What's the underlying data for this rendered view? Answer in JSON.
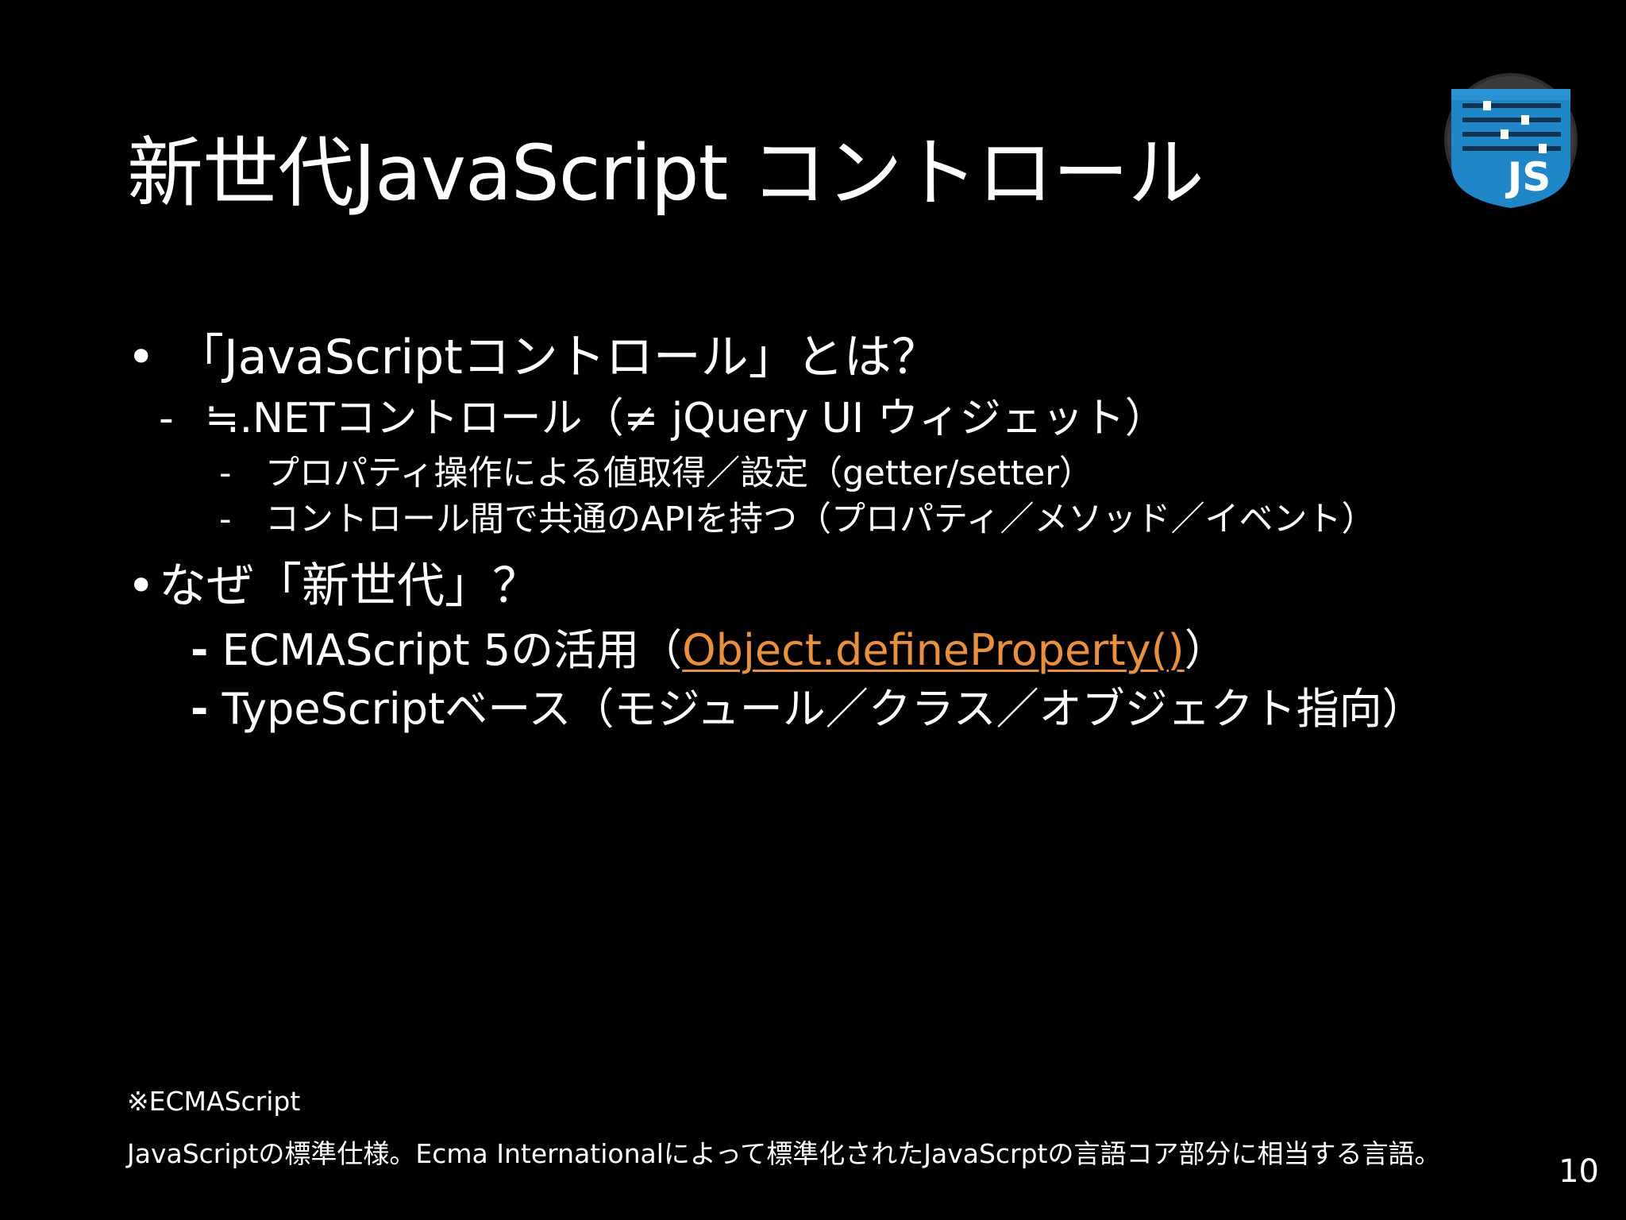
{
  "slide": {
    "title": "新世代JavaScript コントロール",
    "page_number": "10"
  },
  "logo": {
    "icon": "wijmo-js-logo-icon",
    "text": "JS",
    "colors": {
      "shield": "#1f86c8",
      "shield_dark": "#176a9e",
      "ring": "#3a3a3a"
    }
  },
  "bullets": {
    "marker": "•",
    "dash": "-",
    "b1": {
      "text": "「JavaScriptコントロール」とは？",
      "sub": {
        "text": "≒.NETコントロール（≠ jQuery UI ウィジェット）",
        "items": [
          "プロパティ操作による値取得／設定（getter/setter）",
          "コントロール間で共通のAPIを持つ（プロパティ／メソッド／イベント）"
        ]
      }
    },
    "b2": {
      "text": "なぜ「新世代」？",
      "items": {
        "i1_prefix": "ECMAScript 5の活用（",
        "i1_link": "Object.defineProperty()",
        "i1_suffix": "）",
        "i2": "TypeScriptベース（モジュール／クラス／オブジェクト指向）"
      }
    }
  },
  "footnote": {
    "heading": "※ECMAScript",
    "body": "JavaScriptの標準仕様。Ecma Internationalによって標準化されたJavaScrptの言語コア部分に相当する言語。"
  },
  "colors": {
    "background": "#000000",
    "text": "#ffffff",
    "link": "#e8903f"
  }
}
